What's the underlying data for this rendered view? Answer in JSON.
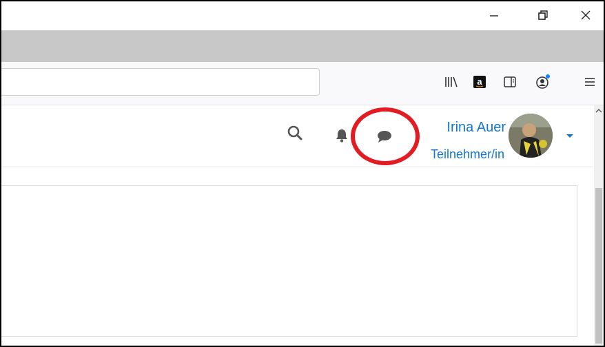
{
  "window": {
    "controls": {
      "minimize_icon": "minimize-icon",
      "restore_icon": "restore-icon",
      "close_icon": "close-icon"
    }
  },
  "toolbar": {
    "url_value": "",
    "icons": [
      "library-icon",
      "amazon-icon",
      "sidebar-icon",
      "account-icon",
      "hamburger-menu-icon"
    ],
    "account_badge_color": "#0a84ff"
  },
  "header": {
    "icons": [
      "search-icon",
      "bell-icon",
      "chat-icon"
    ],
    "user": {
      "name": "Irina Auer",
      "role": "Teilnehmer/in"
    },
    "link_color": "#1177d1"
  },
  "annotation": {
    "color": "#e31b23",
    "target": "chat-icon"
  }
}
